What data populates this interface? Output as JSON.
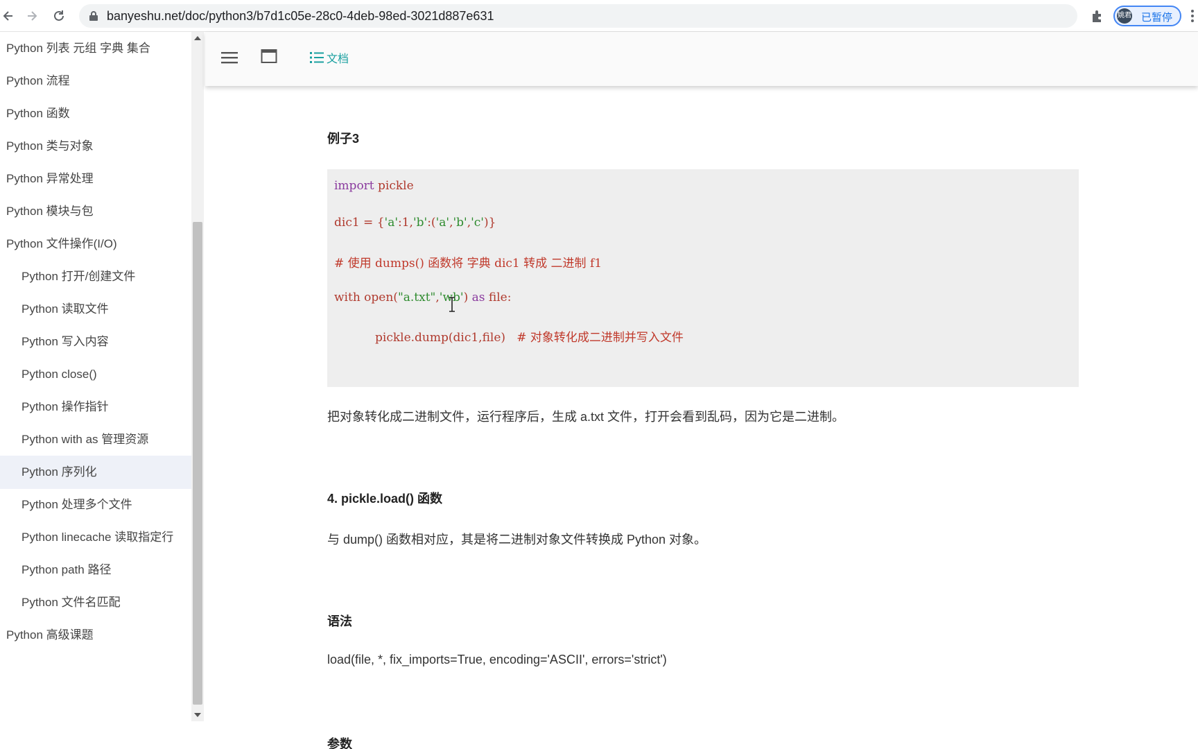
{
  "browser": {
    "url": "banyeshu.net/doc/python3/b7d1c05e-28c0-4deb-98ed-3021d887e631",
    "profile_avatar_text": "姚君",
    "profile_label": "已暂停"
  },
  "toolbar": {
    "doc_label": "文档",
    "accent_color": "#1aa0a0"
  },
  "sidebar": {
    "items": [
      {
        "label": "Python 列表 元组 字典 集合"
      },
      {
        "label": "Python 流程"
      },
      {
        "label": "Python 函数"
      },
      {
        "label": "Python 类与对象"
      },
      {
        "label": "Python 异常处理"
      },
      {
        "label": "Python 模块与包"
      },
      {
        "label": "Python 文件操作(I/O)"
      },
      {
        "label": "Python 打开/创建文件"
      },
      {
        "label": "Python 读取文件"
      },
      {
        "label": "Python 写入内容"
      },
      {
        "label": "Python close()"
      },
      {
        "label": "Python 操作指针"
      },
      {
        "label": "Python with as 管理资源"
      },
      {
        "label": "Python 序列化"
      },
      {
        "label": "Python 处理多个文件"
      },
      {
        "label": "Python linecache 读取指定行"
      },
      {
        "label": "Python path 路径"
      },
      {
        "label": "Python 文件名匹配"
      },
      {
        "label": "Python 高级课题"
      }
    ]
  },
  "content": {
    "example_heading": "例子3",
    "code": {
      "l1_kw": "import",
      "l1_rest": " pickle",
      "l2_a": "dic1 = {",
      "l2_b": "'a'",
      "l2_c": ":1,",
      "l2_d": "'b'",
      "l2_e": ":(",
      "l2_f": "'a'",
      "l2_g": ",",
      "l2_h": "'b'",
      "l2_i": ",",
      "l2_j": "'c'",
      "l2_k": ")}",
      "l3": "# 使用 dumps() 函数将 字典 dic1 转成 二进制 f1",
      "l4_a": "with open(",
      "l4_b": "\"a.txt\"",
      "l4_c": ",",
      "l4_d": "'wb'",
      "l4_e": ") ",
      "l4_f": "as",
      "l4_g": " file:",
      "l5_a": "pickle.dump(dic1,file)",
      "l5_b": "# 对象转化成二进制并写入文件"
    },
    "para1": "把对象转化成二进制文件，运行程序后，生成 a.txt 文件，打开会看到乱码，因为它是二进制。",
    "section4": "4. pickle.load() 函数",
    "para2": "与 dump() 函数相对应，其是将二进制对象文件转换成 Python 对象。",
    "syntax_heading": "语法",
    "syntax_line": "load(file, *, fix_imports=True, encoding='ASCII', errors='strict')",
    "params_heading": "参数"
  }
}
